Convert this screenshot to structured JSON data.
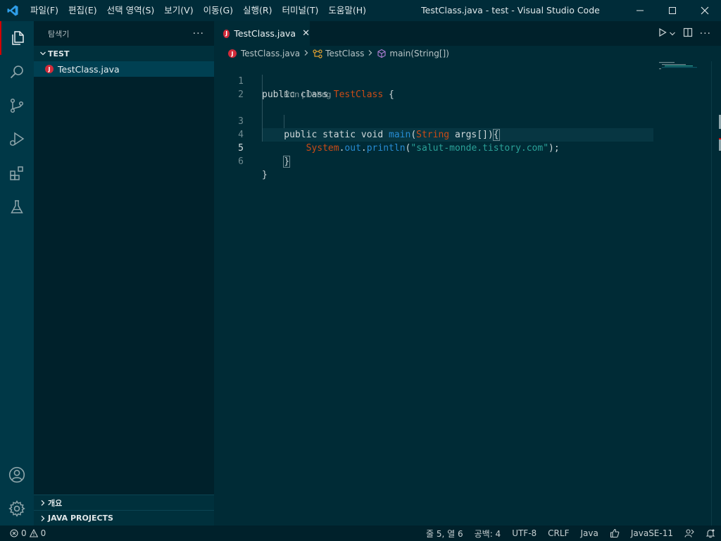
{
  "titlebar": {
    "menu": [
      {
        "label": "파일(F)"
      },
      {
        "label": "편집(E)"
      },
      {
        "label": "선택 영역(S)"
      },
      {
        "label": "보기(V)"
      },
      {
        "label": "이동(G)"
      },
      {
        "label": "실행(R)"
      },
      {
        "label": "터미널(T)"
      },
      {
        "label": "도움말(H)"
      }
    ],
    "window_title": "TestClass.java - test - Visual Studio Code"
  },
  "activitybar": {
    "items": [
      "explorer-icon",
      "search-icon",
      "source-control-icon",
      "run-debug-icon",
      "extensions-icon",
      "testing-icon"
    ],
    "bottom": [
      "account-icon",
      "settings-gear-icon"
    ],
    "accent_color": "#d30102"
  },
  "sidebar": {
    "header": "탐색기",
    "more": "···",
    "folder": "TEST",
    "files": [
      {
        "name": "TestClass.java",
        "icon_letter": "J"
      }
    ],
    "bottom_sections": [
      "개요",
      "JAVA PROJECTS"
    ]
  },
  "editor": {
    "tab": {
      "label": "TestClass.java",
      "close": "✕"
    },
    "breadcrumb": [
      "TestClass.java",
      "TestClass",
      "main(String[])"
    ],
    "codelens": "Run | Debug",
    "lines": [
      {
        "n": "1",
        "tokens": [
          {
            "t": "public class ",
            "c": "kw"
          },
          {
            "t": "TestClass",
            "c": "cls"
          },
          {
            "t": " {",
            "c": "kw"
          }
        ]
      },
      {
        "n": "2",
        "tokens": []
      },
      {
        "n": "3",
        "tokens": [
          {
            "t": "    public static void ",
            "c": "kw"
          },
          {
            "t": "main",
            "c": "fn"
          },
          {
            "t": "(",
            "c": "kw"
          },
          {
            "t": "String",
            "c": "cls"
          },
          {
            "t": " args[])",
            "c": "kw"
          },
          {
            "t": "{",
            "c": "kw"
          }
        ]
      },
      {
        "n": "4",
        "tokens": [
          {
            "t": "        ",
            "c": "kw"
          },
          {
            "t": "System",
            "c": "cls"
          },
          {
            "t": ".",
            "c": "kw"
          },
          {
            "t": "out",
            "c": "fn"
          },
          {
            "t": ".",
            "c": "kw"
          },
          {
            "t": "println",
            "c": "fn"
          },
          {
            "t": "(",
            "c": "kw"
          },
          {
            "t": "\"salut-monde.tistory.com\"",
            "c": "str"
          },
          {
            "t": ");",
            "c": "kw"
          }
        ]
      },
      {
        "n": "5",
        "tokens": [
          {
            "t": "    }",
            "c": "kw"
          }
        ]
      },
      {
        "n": "6",
        "tokens": [
          {
            "t": "}",
            "c": "kw"
          }
        ]
      }
    ],
    "active_line": "5"
  },
  "statusbar": {
    "errors": "0",
    "warnings": "0",
    "position": "줄 5, 열 6",
    "indent": "공백: 4",
    "encoding": "UTF-8",
    "eol": "CRLF",
    "language": "Java",
    "runtime": "JavaSE-11"
  }
}
